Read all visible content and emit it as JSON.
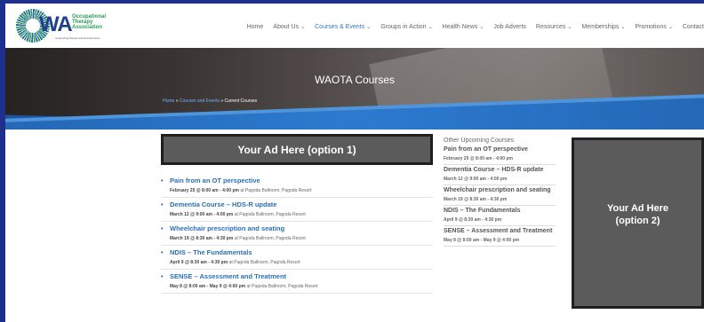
{
  "logo": {
    "wa": "WA",
    "assoc": "Occupational Therapy Association",
    "tagline": "Connecting People and Environments"
  },
  "nav": [
    {
      "label": "Home",
      "chevron": false,
      "active": false
    },
    {
      "label": "About Us",
      "chevron": true,
      "active": false
    },
    {
      "label": "Courses & Events",
      "chevron": true,
      "active": true
    },
    {
      "label": "Groups in Action",
      "chevron": true,
      "active": false
    },
    {
      "label": "Health News",
      "chevron": true,
      "active": false
    },
    {
      "label": "Job Adverts",
      "chevron": false,
      "active": false
    },
    {
      "label": "Resources",
      "chevron": true,
      "active": false
    },
    {
      "label": "Memberships",
      "chevron": true,
      "active": false
    },
    {
      "label": "Promotions",
      "chevron": true,
      "active": false
    },
    {
      "label": "Contact",
      "chevron": false,
      "active": false
    }
  ],
  "banner": {
    "title": "WAOTA Courses",
    "breadcrumb": {
      "home": "Home",
      "sep1": " » ",
      "section": "Courses and Events",
      "sep2": " » ",
      "current": "Current Courses"
    }
  },
  "ad1": {
    "label": "Your Ad Here (option 1)"
  },
  "ad2": {
    "line1": "Your Ad Here",
    "line2": "(option 2)"
  },
  "events": [
    {
      "title": "Pain from an OT perspective",
      "when": "February 25 @ 8:00 am - 4:00 pm",
      "where": "at Pagoda Ballroom, Pagoda Resort"
    },
    {
      "title": "Dementia Course – HDS-R update",
      "when": "March 12 @ 9:00 am - 4:00 pm",
      "where": "at Pagoda Ballroom, Pagoda Resort"
    },
    {
      "title": "Wheelchair prescription and seating",
      "when": "March 19 @ 8:30 am - 4:30 pm",
      "where": "at Pagoda Ballroom, Pagoda Resort"
    },
    {
      "title": "NDIS – The Fundamentals",
      "when": "April 9 @ 8:30 am - 4:30 pm",
      "where": "at Pagoda Ballroom, Pagoda Resort"
    },
    {
      "title": "SENSE – Assessment and Treatment",
      "when": "May 8 @ 8:00 am - May 9 @ 4:00 pm",
      "where": "at Pagoda Ballroom, Pagoda Resort"
    }
  ],
  "sidebar": {
    "heading": "Other Upcoming Courses",
    "items": [
      {
        "title": "Pain from an OT perspective",
        "date": "February 25 @ 8:00 am - 4:00 pm"
      },
      {
        "title": "Dementia Course – HDS-R update",
        "date": "March 12 @ 9:00 am - 4:00 pm"
      },
      {
        "title": "Wheelchair prescription and seating",
        "date": "March 19 @ 8:30 am - 4:30 pm"
      },
      {
        "title": "NDIS – The Fundamentals",
        "date": "April 9 @ 8:30 am - 4:30 pm"
      },
      {
        "title": "SENSE – Assessment and Treatment",
        "date": "May 8 @ 8:00 am - May 9 @ 4:00 pm"
      }
    ]
  },
  "colors": {
    "background": "#1e2f8c",
    "link": "#2a6fb7",
    "nav_active": "#2f7ac1",
    "ad_bg": "#5b5b5b"
  }
}
